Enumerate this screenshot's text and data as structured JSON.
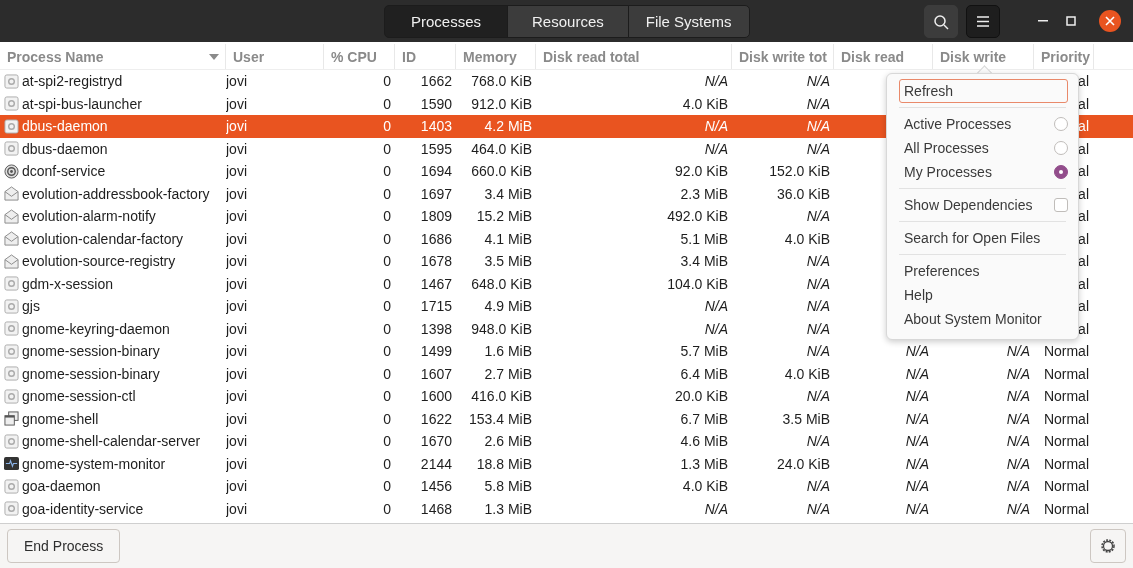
{
  "header_bar": {
    "tabs": [
      {
        "label": "Processes",
        "selected": true
      },
      {
        "label": "Resources",
        "selected": false
      },
      {
        "label": "File Systems",
        "selected": false
      }
    ],
    "menu_button_active": true
  },
  "table": {
    "columns": [
      {
        "label": "Process Name",
        "sorted": true
      },
      {
        "label": "User",
        "sorted": false
      },
      {
        "label": "% CPU",
        "sorted": false
      },
      {
        "label": "ID",
        "sorted": false
      },
      {
        "label": "Memory",
        "sorted": false
      },
      {
        "label": "Disk read total",
        "sorted": false
      },
      {
        "label": "Disk write tot",
        "sorted": false
      },
      {
        "label": "Disk read",
        "sorted": false
      },
      {
        "label": "Disk write",
        "sorted": false
      },
      {
        "label": "Priority",
        "sorted": false
      }
    ],
    "rows": [
      {
        "kind": "gear",
        "name": "at-spi2-registryd",
        "user": "jovi",
        "cpu": "0",
        "id": "1662",
        "memory": "768.0 KiB",
        "disk_read_total": "N/A",
        "disk_write_total": "N/A",
        "priority": "al",
        "selected": false
      },
      {
        "kind": "gear",
        "name": "at-spi-bus-launcher",
        "user": "jovi",
        "cpu": "0",
        "id": "1590",
        "memory": "912.0 KiB",
        "disk_read_total": "4.0 KiB",
        "disk_write_total": "N/A",
        "priority": "al",
        "selected": false
      },
      {
        "kind": "gear",
        "name": "dbus-daemon",
        "user": "jovi",
        "cpu": "0",
        "id": "1403",
        "memory": "4.2 MiB",
        "disk_read_total": "N/A",
        "disk_write_total": "N/A",
        "priority": "al",
        "selected": true
      },
      {
        "kind": "gear",
        "name": "dbus-daemon",
        "user": "jovi",
        "cpu": "0",
        "id": "1595",
        "memory": "464.0 KiB",
        "disk_read_total": "N/A",
        "disk_write_total": "N/A",
        "priority": "al",
        "selected": false
      },
      {
        "kind": "disc",
        "name": "dconf-service",
        "user": "jovi",
        "cpu": "0",
        "id": "1694",
        "memory": "660.0 KiB",
        "disk_read_total": "92.0 KiB",
        "disk_write_total": "152.0 KiB",
        "priority": "al",
        "selected": false
      },
      {
        "kind": "envelope",
        "name": "evolution-addressbook-factory",
        "user": "jovi",
        "cpu": "0",
        "id": "1697",
        "memory": "3.4 MiB",
        "disk_read_total": "2.3 MiB",
        "disk_write_total": "36.0 KiB",
        "priority": "al",
        "selected": false
      },
      {
        "kind": "envelope",
        "name": "evolution-alarm-notify",
        "user": "jovi",
        "cpu": "0",
        "id": "1809",
        "memory": "15.2 MiB",
        "disk_read_total": "492.0 KiB",
        "disk_write_total": "N/A",
        "priority": "al",
        "selected": false
      },
      {
        "kind": "envelope",
        "name": "evolution-calendar-factory",
        "user": "jovi",
        "cpu": "0",
        "id": "1686",
        "memory": "4.1 MiB",
        "disk_read_total": "5.1 MiB",
        "disk_write_total": "4.0 KiB",
        "priority": "al",
        "selected": false
      },
      {
        "kind": "envelope",
        "name": "evolution-source-registry",
        "user": "jovi",
        "cpu": "0",
        "id": "1678",
        "memory": "3.5 MiB",
        "disk_read_total": "3.4 MiB",
        "disk_write_total": "N/A",
        "priority": "al",
        "selected": false
      },
      {
        "kind": "gear",
        "name": "gdm-x-session",
        "user": "jovi",
        "cpu": "0",
        "id": "1467",
        "memory": "648.0 KiB",
        "disk_read_total": "104.0 KiB",
        "disk_write_total": "N/A",
        "priority": "al",
        "selected": false
      },
      {
        "kind": "gear",
        "name": "gjs",
        "user": "jovi",
        "cpu": "0",
        "id": "1715",
        "memory": "4.9 MiB",
        "disk_read_total": "N/A",
        "disk_write_total": "N/A",
        "priority": "al",
        "selected": false
      },
      {
        "kind": "gear",
        "name": "gnome-keyring-daemon",
        "user": "jovi",
        "cpu": "0",
        "id": "1398",
        "memory": "948.0 KiB",
        "disk_read_total": "N/A",
        "disk_write_total": "N/A",
        "priority": "al",
        "selected": false
      },
      {
        "kind": "gear",
        "name": "gnome-session-binary",
        "user": "jovi",
        "cpu": "0",
        "id": "1499",
        "memory": "1.6 MiB",
        "disk_read_total": "5.7 MiB",
        "disk_write_total": "N/A",
        "disk_read": "N/A",
        "disk_write": "N/A",
        "priority": "Normal",
        "selected": false
      },
      {
        "kind": "gear",
        "name": "gnome-session-binary",
        "user": "jovi",
        "cpu": "0",
        "id": "1607",
        "memory": "2.7 MiB",
        "disk_read_total": "6.4 MiB",
        "disk_write_total": "4.0 KiB",
        "disk_read": "N/A",
        "disk_write": "N/A",
        "priority": "Normal",
        "selected": false
      },
      {
        "kind": "gear",
        "name": "gnome-session-ctl",
        "user": "jovi",
        "cpu": "0",
        "id": "1600",
        "memory": "416.0 KiB",
        "disk_read_total": "20.0 KiB",
        "disk_write_total": "N/A",
        "disk_read": "N/A",
        "disk_write": "N/A",
        "priority": "Normal",
        "selected": false
      },
      {
        "kind": "windows",
        "name": "gnome-shell",
        "user": "jovi",
        "cpu": "0",
        "id": "1622",
        "memory": "153.4 MiB",
        "disk_read_total": "6.7 MiB",
        "disk_write_total": "3.5 MiB",
        "disk_read": "N/A",
        "disk_write": "N/A",
        "priority": "Normal",
        "selected": false
      },
      {
        "kind": "gear",
        "name": "gnome-shell-calendar-server",
        "user": "jovi",
        "cpu": "0",
        "id": "1670",
        "memory": "2.6 MiB",
        "disk_read_total": "4.6 MiB",
        "disk_write_total": "N/A",
        "disk_read": "N/A",
        "disk_write": "N/A",
        "priority": "Normal",
        "selected": false
      },
      {
        "kind": "monitor",
        "name": "gnome-system-monitor",
        "user": "jovi",
        "cpu": "0",
        "id": "2144",
        "memory": "18.8 MiB",
        "disk_read_total": "1.3 MiB",
        "disk_write_total": "24.0 KiB",
        "disk_read": "N/A",
        "disk_write": "N/A",
        "priority": "Normal",
        "selected": false
      },
      {
        "kind": "gear",
        "name": "goa-daemon",
        "user": "jovi",
        "cpu": "0",
        "id": "1456",
        "memory": "5.8 MiB",
        "disk_read_total": "4.0 KiB",
        "disk_write_total": "N/A",
        "disk_read": "N/A",
        "disk_write": "N/A",
        "priority": "Normal",
        "selected": false
      },
      {
        "kind": "gear",
        "name": "goa-identity-service",
        "user": "jovi",
        "cpu": "0",
        "id": "1468",
        "memory": "1.3 MiB",
        "disk_read_total": "N/A",
        "disk_write_total": "N/A",
        "disk_read": "N/A",
        "disk_write": "N/A",
        "priority": "Normal",
        "selected": false
      }
    ]
  },
  "menu": {
    "items": [
      {
        "kind": "action",
        "label": "Refresh",
        "focused": true
      },
      {
        "kind": "separator"
      },
      {
        "kind": "radio",
        "label": "Active Processes",
        "selected": false
      },
      {
        "kind": "radio",
        "label": "All Processes",
        "selected": false
      },
      {
        "kind": "radio",
        "label": "My Processes",
        "selected": true
      },
      {
        "kind": "separator"
      },
      {
        "kind": "check",
        "label": "Show Dependencies",
        "checked": false
      },
      {
        "kind": "separator"
      },
      {
        "kind": "action",
        "label": "Search for Open Files",
        "focused": false
      },
      {
        "kind": "separator"
      },
      {
        "kind": "action",
        "label": "Preferences",
        "focused": false
      },
      {
        "kind": "action",
        "label": "Help",
        "focused": false
      },
      {
        "kind": "action",
        "label": "About System Monitor",
        "focused": false
      }
    ]
  },
  "footer": {
    "end_button": "End Process"
  }
}
